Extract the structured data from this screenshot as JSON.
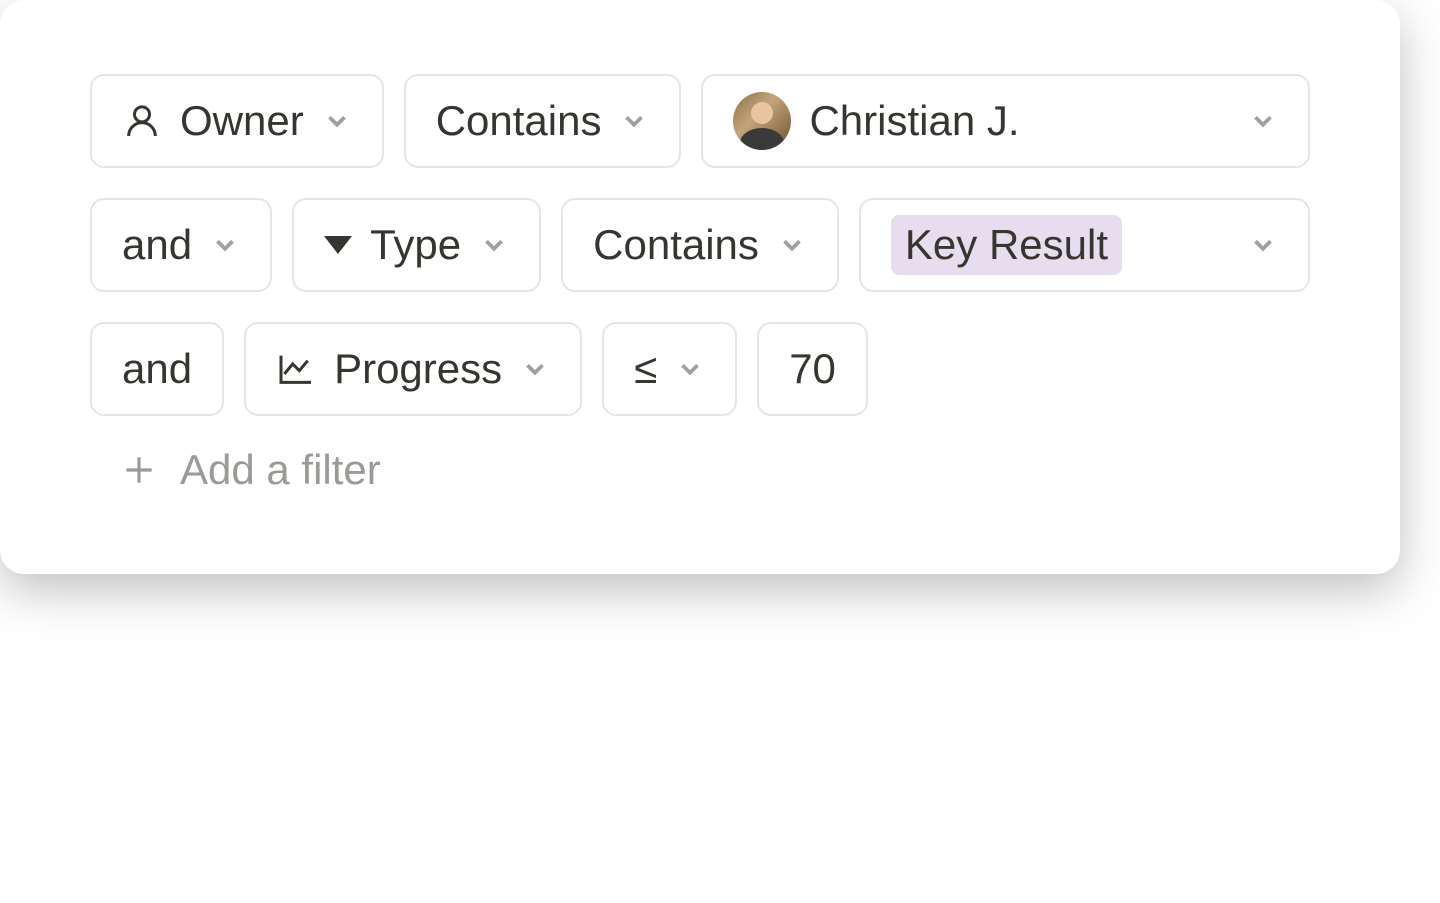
{
  "filters": {
    "row1": {
      "property": "Owner",
      "operator": "Contains",
      "value": "Christian J."
    },
    "row2": {
      "conjunction": "and",
      "property": "Type",
      "operator": "Contains",
      "value": "Key Result"
    },
    "row3": {
      "conjunction": "and",
      "property": "Progress",
      "operator": "≤",
      "value": "70"
    }
  },
  "actions": {
    "addFilter": "Add a filter"
  }
}
